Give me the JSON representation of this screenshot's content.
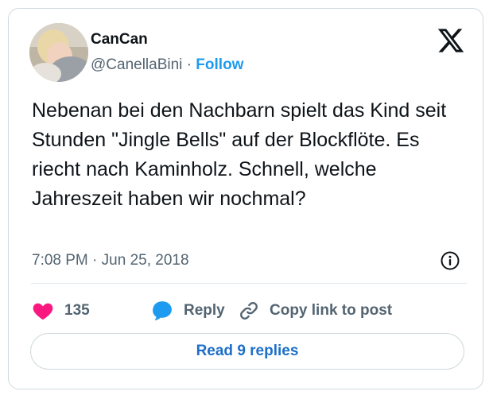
{
  "user": {
    "display_name": "CanCan",
    "handle": "@CanellaBini",
    "separator": "·",
    "follow_label": "Follow"
  },
  "tweet": {
    "text": "Nebenan bei den Nachbarn spielt das Kind seit Stunden \"Jingle Bells\" auf der Blockflöte. Es riecht nach Kaminholz. Schnell, welche Jahreszeit haben wir nochmal?",
    "time": "7:08 PM",
    "separator": "·",
    "date": "Jun 25, 2018"
  },
  "actions": {
    "like_count": "135",
    "reply_label": "Reply",
    "copy_label": "Copy link to post"
  },
  "read_replies_label": "Read 9 replies",
  "icons": {
    "logo": "x-logo-icon",
    "info": "info-icon",
    "like": "heart-icon",
    "reply": "speech-bubble-icon",
    "copy": "link-icon"
  },
  "colors": {
    "like": "#f91880",
    "reply": "#1d9bf0",
    "follow": "#1d9bf0",
    "read_button_text": "#1d6fc8"
  }
}
